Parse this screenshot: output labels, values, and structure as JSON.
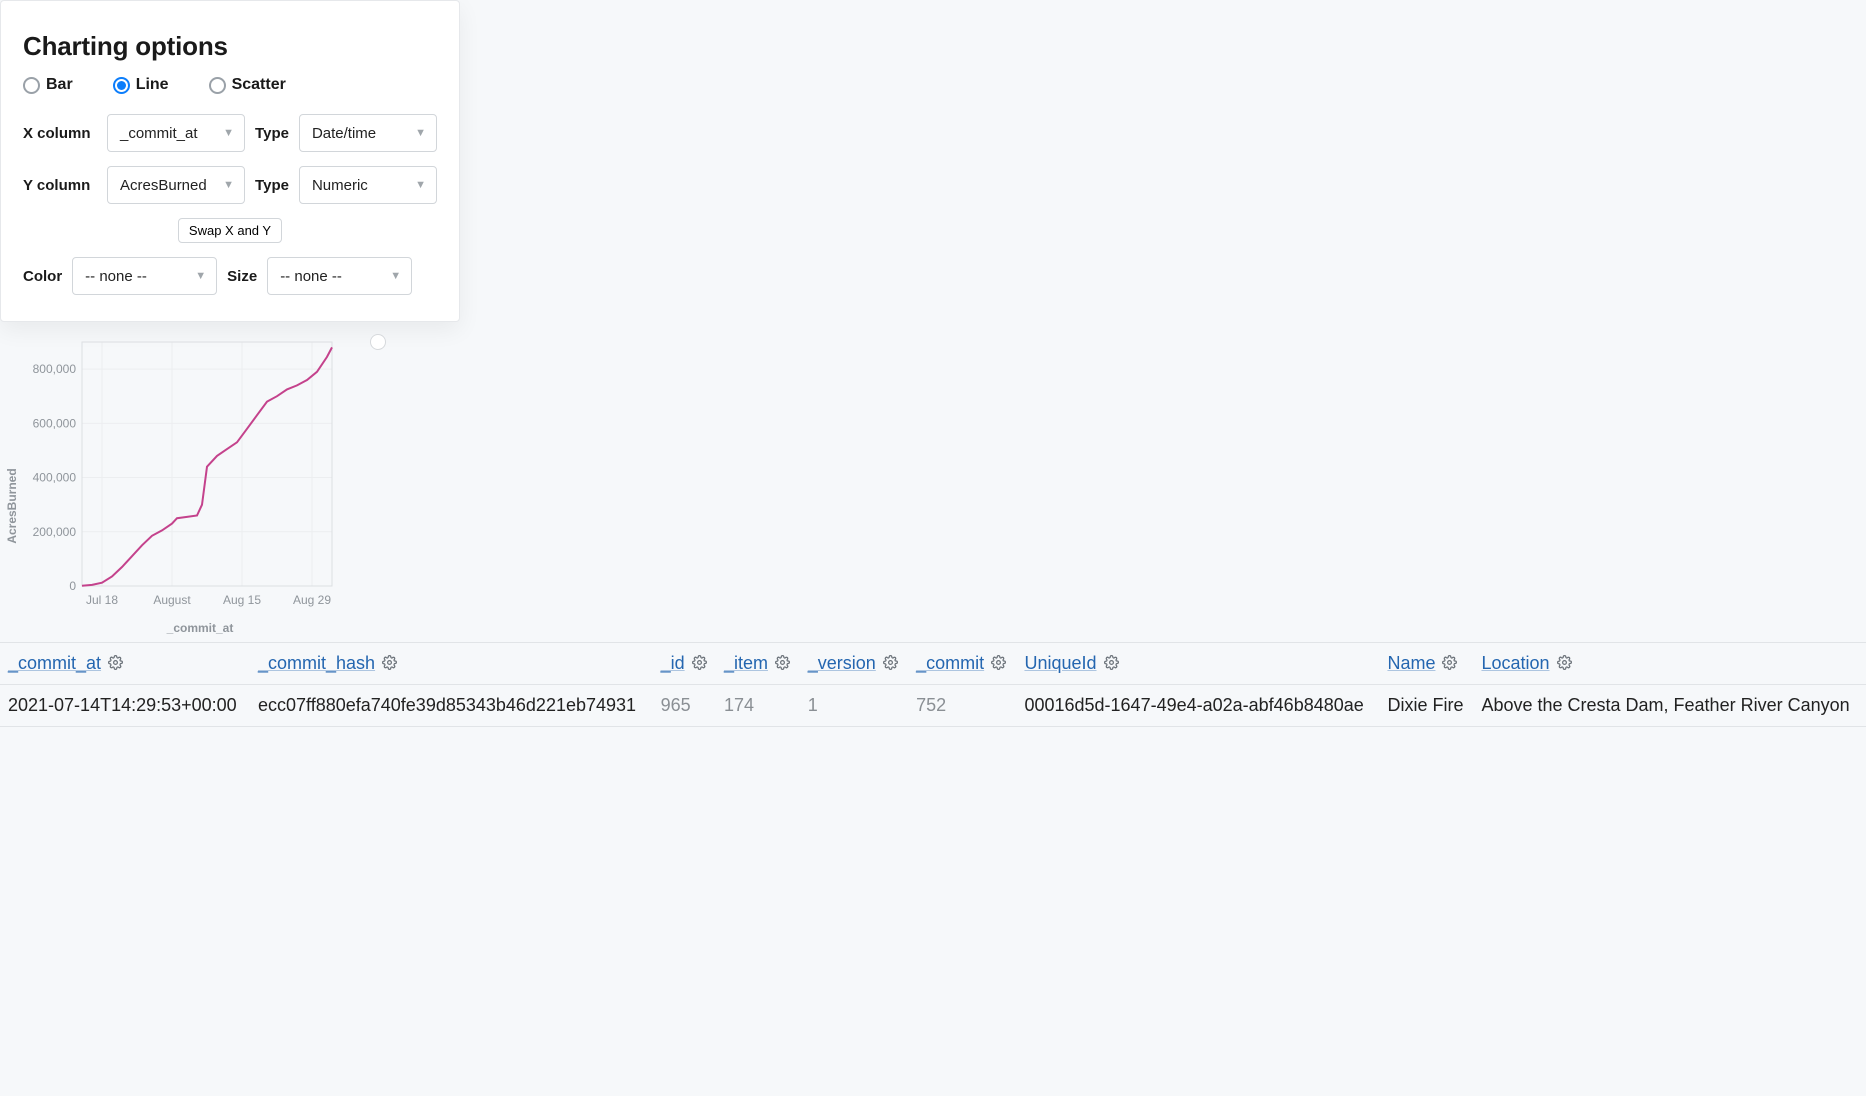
{
  "panel": {
    "title": "Charting options",
    "chart_types": [
      {
        "label": "Bar",
        "selected": false
      },
      {
        "label": "Line",
        "selected": true
      },
      {
        "label": "Scatter",
        "selected": false
      }
    ],
    "x": {
      "label": "X column",
      "value": "_commit_at",
      "type_label": "Type",
      "type_value": "Date/time"
    },
    "y": {
      "label": "Y column",
      "value": "AcresBurned",
      "type_label": "Type",
      "type_value": "Numeric"
    },
    "swap_label": "Swap X and Y",
    "color": {
      "label": "Color",
      "value": "-- none --"
    },
    "size": {
      "label": "Size",
      "value": "-- none --"
    }
  },
  "chart_data": {
    "type": "line",
    "title": "",
    "xlabel": "_commit_at",
    "ylabel": "AcresBurned",
    "x_ticks": [
      "Jul 18",
      "August",
      "Aug 15",
      "Aug 29"
    ],
    "y_ticks": [
      0,
      200000,
      400000,
      600000,
      800000
    ],
    "ylim": [
      0,
      900000
    ],
    "series": [
      {
        "name": "AcresBurned",
        "x": [
          "2021-07-14",
          "2021-07-16",
          "2021-07-18",
          "2021-07-20",
          "2021-07-22",
          "2021-07-24",
          "2021-07-26",
          "2021-07-28",
          "2021-07-30",
          "2021-08-01",
          "2021-08-02",
          "2021-08-04",
          "2021-08-06",
          "2021-08-07",
          "2021-08-08",
          "2021-08-10",
          "2021-08-12",
          "2021-08-14",
          "2021-08-16",
          "2021-08-18",
          "2021-08-20",
          "2021-08-22",
          "2021-08-24",
          "2021-08-26",
          "2021-08-28",
          "2021-08-30",
          "2021-09-01",
          "2021-09-02"
        ],
        "y": [
          1000,
          4000,
          12000,
          35000,
          70000,
          110000,
          150000,
          185000,
          205000,
          230000,
          250000,
          255000,
          260000,
          300000,
          440000,
          480000,
          505000,
          530000,
          580000,
          630000,
          680000,
          700000,
          725000,
          740000,
          760000,
          790000,
          845000,
          880000
        ]
      }
    ]
  },
  "table": {
    "columns": [
      "_commit_at",
      "_commit_hash",
      "_id",
      "_item",
      "_version",
      "_commit",
      "UniqueId",
      "Name",
      "Location"
    ],
    "rows": [
      {
        "_commit_at": "2021-07-14T14:29:53+00:00",
        "_commit_hash": "ecc07ff880efa740fe39d85343b46d221eb74931",
        "_id": "965",
        "_item": "174",
        "_version": "1",
        "_commit": "752",
        "UniqueId": "00016d5d-1647-49e4-a02a-abf46b8480ae",
        "Name": "Dixie Fire",
        "Location": "Above the Cresta Dam, Feather River Canyon"
      }
    ]
  }
}
